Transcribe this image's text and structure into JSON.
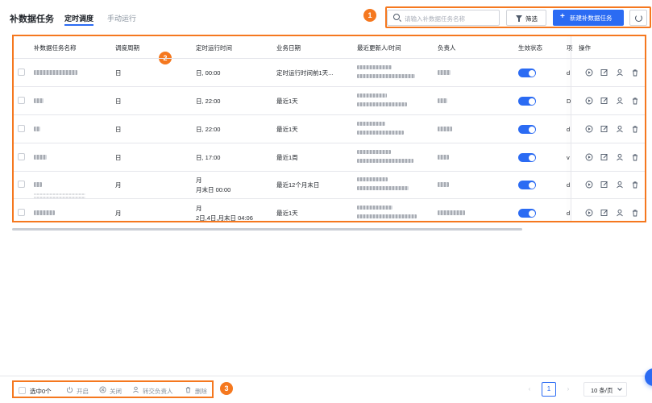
{
  "header": {
    "title": "补数据任务",
    "tabs": [
      {
        "label": "定时调度",
        "active": true
      },
      {
        "label": "手动运行",
        "active": false
      }
    ]
  },
  "toolbar": {
    "search_placeholder": "请输入补数据任务名称",
    "filter_label": "筛选",
    "new_label": "新建补数据任务",
    "new_icon": "plus-icon",
    "refresh_icon": "refresh-icon"
  },
  "annotations": [
    "1",
    "2",
    "3"
  ],
  "table": {
    "columns": [
      "补数据任务名称",
      "调度周期",
      "定时运行时间",
      "业务日期",
      "最近更新人/时间",
      "负责人",
      "生效状态",
      "项",
      "操作"
    ],
    "rows": [
      {
        "period": "日",
        "time_lines": [
          "日, 00:00"
        ],
        "biz_date": "定时运行时间前1天...",
        "enabled": true,
        "trunc": "d"
      },
      {
        "period": "日",
        "time_lines": [
          "日, 22:00"
        ],
        "biz_date": "最近1天",
        "enabled": true,
        "trunc": "D"
      },
      {
        "period": "日",
        "time_lines": [
          "日, 22:00"
        ],
        "biz_date": "最近1天",
        "enabled": true,
        "trunc": "d"
      },
      {
        "period": "日",
        "time_lines": [
          "日, 17:00"
        ],
        "biz_date": "最近1周",
        "enabled": true,
        "trunc": "v"
      },
      {
        "period": "月",
        "time_lines": [
          "月",
          "月末日 00:00"
        ],
        "biz_date": "最近12个月末日",
        "enabled": true,
        "trunc": "d"
      },
      {
        "period": "月",
        "time_lines": [
          "月",
          "2日,4日,月末日 04:06"
        ],
        "biz_date": "最近1天",
        "enabled": true,
        "trunc": "d"
      }
    ],
    "row_actions": [
      "run-icon",
      "edit-icon",
      "transfer-owner-icon",
      "delete-icon"
    ]
  },
  "footer": {
    "selected_label": "选中0个",
    "bulk_actions": [
      {
        "label": "开启",
        "icon": "power-icon"
      },
      {
        "label": "关闭",
        "icon": "close-circle-icon"
      },
      {
        "label": "转交负责人",
        "icon": "transfer-owner-icon"
      },
      {
        "label": "删除",
        "icon": "delete-icon"
      }
    ],
    "pagination": {
      "current_page": "1",
      "prev": "‹",
      "next": "›",
      "page_size_label": "10 条/页"
    }
  },
  "colors": {
    "primary": "#2b6bf3",
    "annotation": "#f5781f",
    "border": "#e5e6eb"
  }
}
